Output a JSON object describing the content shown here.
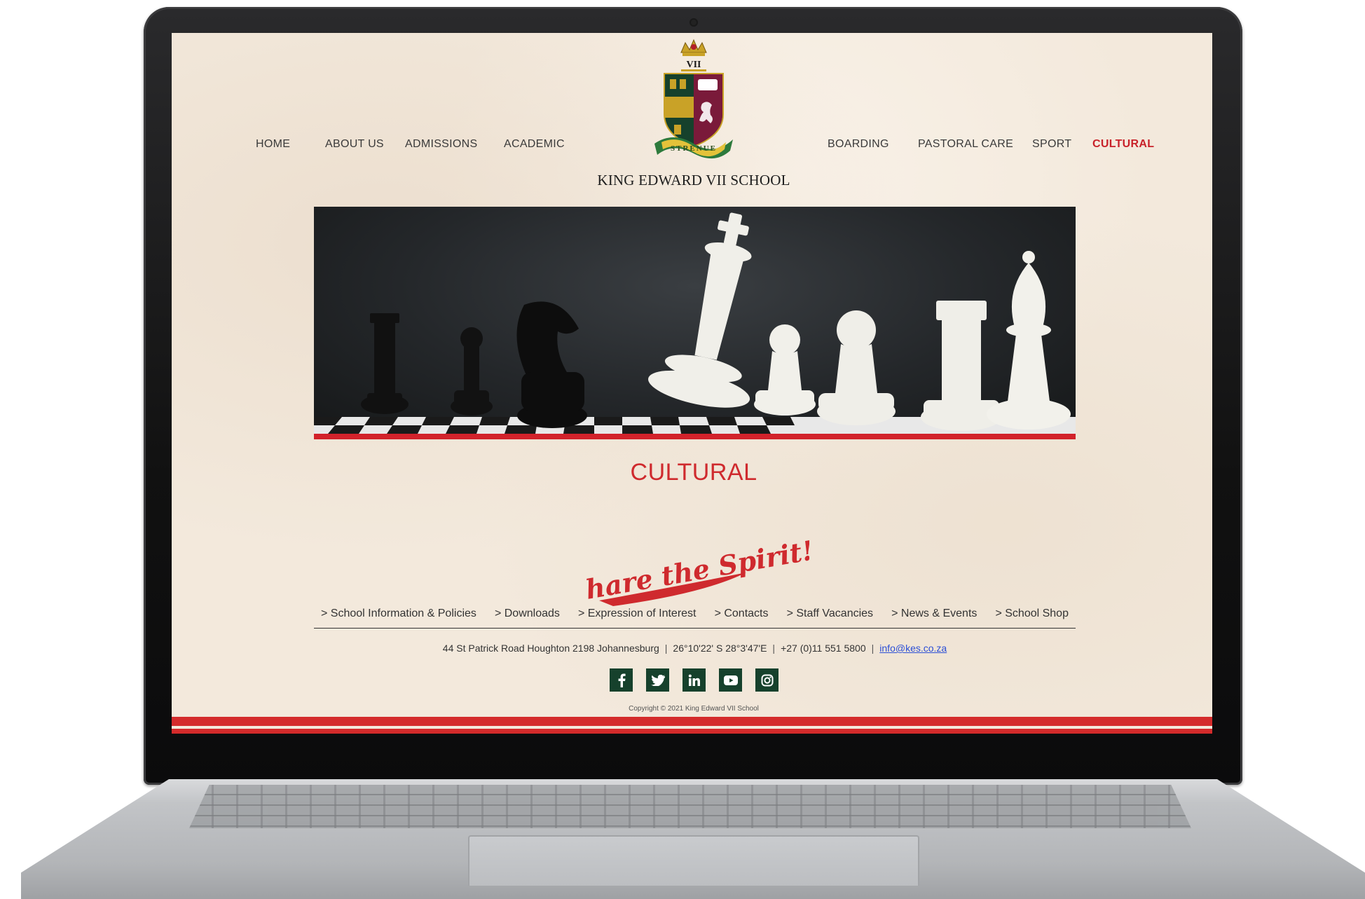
{
  "nav": {
    "home": "HOME",
    "about": "ABOUT US",
    "admissions": "ADMISSIONS",
    "academic": "ACADEMIC",
    "boarding": "BOARDING",
    "pastoral": "PASTORAL CARE",
    "sport": "SPORT",
    "cultural": "CULTURAL",
    "active": "CULTURAL"
  },
  "crest": {
    "numeral": "VII",
    "motto": "STRENUE"
  },
  "school_name": "KING EDWARD VII SCHOOL",
  "hero_image": "chess-pieces-photo",
  "page_title": "CULTURAL",
  "slogan": "Share the Spirit!",
  "footer_links": [
    "> School Information & Policies",
    "> Downloads",
    "> Expression of Interest",
    "> Contacts",
    "> Staff Vacancies",
    "> News & Events",
    "> School Shop"
  ],
  "contact": {
    "address": "44 St Patrick Road Houghton 2198 Johannesburg",
    "coordinates": "26°10'22' S 28°3'47'E",
    "phone": "+27 (0)11 551 5800",
    "email": "info@kes.co.za"
  },
  "social_icons": [
    "facebook-icon",
    "twitter-icon",
    "linkedin-icon",
    "youtube-icon",
    "instagram-icon"
  ],
  "copyright": "Copyright © 2021 King Edward VII School",
  "colors": {
    "accent_red": "#d42b2b",
    "crest_green": "#16412c",
    "crest_maroon": "#7a1a3a",
    "background": "#f3e9dc"
  }
}
